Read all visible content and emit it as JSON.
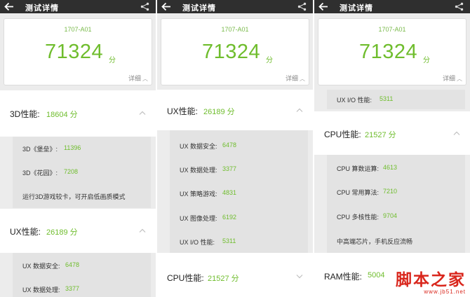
{
  "panels": [
    {
      "title": "测试详情",
      "device": "1707-A01",
      "score": "71324",
      "score_unit": "分",
      "detail_label": "详细",
      "categories": [
        {
          "label": "3D性能:",
          "score": "18604 分"
        },
        {
          "label": "UX性能:",
          "score": "26189 分"
        }
      ],
      "rows": [
        {
          "label": "3D《堡垒》:",
          "value": "11396"
        },
        {
          "label": "3D《花园》:",
          "value": "7208"
        },
        {
          "note": "运行3D游戏较卡，可开启低画质模式"
        },
        {
          "label": "UX 数据安全:",
          "value": "6478"
        },
        {
          "label": "UX 数据处理:",
          "value": "3377"
        }
      ]
    },
    {
      "title": "测试详情",
      "device": "1707-A01",
      "score": "71324",
      "score_unit": "分",
      "detail_label": "详细",
      "categories": [
        {
          "label": "UX性能:",
          "score": "26189 分"
        },
        {
          "label": "CPU性能:",
          "score": "21527 分"
        }
      ],
      "rows": [
        {
          "label": "UX 数据安全:",
          "value": "6478"
        },
        {
          "label": "UX 数据处理:",
          "value": "3377"
        },
        {
          "label": "UX 策略游戏:",
          "value": "4831"
        },
        {
          "label": "UX 图像处理:",
          "value": "6192"
        },
        {
          "label": "UX I/O 性能:",
          "value": "5311"
        }
      ]
    },
    {
      "title": "测试详情",
      "device": "1707-A01",
      "score": "71324",
      "score_unit": "分",
      "detail_label": "详细",
      "categories": [
        {
          "label": "CPU性能:",
          "score": "21527 分"
        },
        {
          "label": "RAM性能:",
          "score": "5004"
        }
      ],
      "rows": [
        {
          "label": "UX I/O 性能:",
          "value": "5311"
        },
        {
          "label": "CPU 算数运算:",
          "value": "4613"
        },
        {
          "label": "CPU 常用算法:",
          "value": "7210"
        },
        {
          "label": "CPU 多核性能:",
          "value": "9704"
        },
        {
          "note": "中高端芯片，手机反应流畅"
        }
      ]
    }
  ],
  "watermark": {
    "title": "脚本之家",
    "url": "www.jb51.net"
  },
  "colors": {
    "accent": "#6fbd2d",
    "topbar": "#2f2f2f",
    "watermark": "#d9261c"
  },
  "icons": [
    "back-arrow-icon",
    "share-icon",
    "chevron-up-icon",
    "chevron-down-icon"
  ]
}
